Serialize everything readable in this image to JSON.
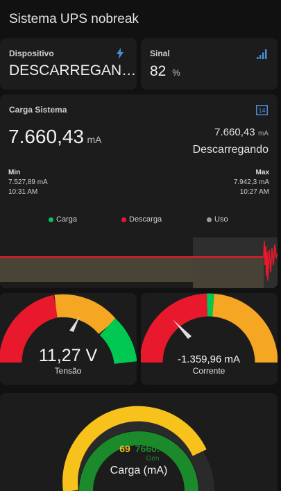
{
  "header": {
    "title": "Sistema UPS nobreak"
  },
  "device": {
    "label": "Dispositivo",
    "value": "DESCARREGAN…",
    "icon": "lightning-icon"
  },
  "signal": {
    "label": "Sinal",
    "value": "82",
    "unit": "%",
    "icon": "signal-bars-icon"
  },
  "load": {
    "label": "Carga Sistema",
    "icon": "sensor-icon",
    "value": "7.660,43",
    "unit": "mA",
    "secondary_value": "7.660,43",
    "secondary_unit": "mA",
    "status": "Descarregando",
    "min": {
      "label": "Min",
      "value": "7.527,89 mA",
      "time": "10:31 AM"
    },
    "max": {
      "label": "Max",
      "value": "7.942,3 mA",
      "time": "10:27 AM"
    },
    "legend": [
      {
        "name": "Carga",
        "color": "#00c853"
      },
      {
        "name": "Descarga",
        "color": "#e8192c"
      },
      {
        "name": "Uso",
        "color": "#9e9e9e"
      }
    ]
  },
  "gauges": {
    "voltage": {
      "value": "11,27 V",
      "label": "Tensão"
    },
    "current": {
      "value": "-1.359,96 mA",
      "label": "Corrente"
    }
  },
  "big_gauge": {
    "outer_value": "69",
    "inner_value": "7660.43",
    "inner_label": "Gen",
    "label": "Carga (mA)"
  },
  "colors": {
    "green": "#00c853",
    "red": "#e8192c",
    "amber": "#f5a623",
    "yellow": "#f6c21b",
    "dark_green": "#1b8a2b"
  }
}
